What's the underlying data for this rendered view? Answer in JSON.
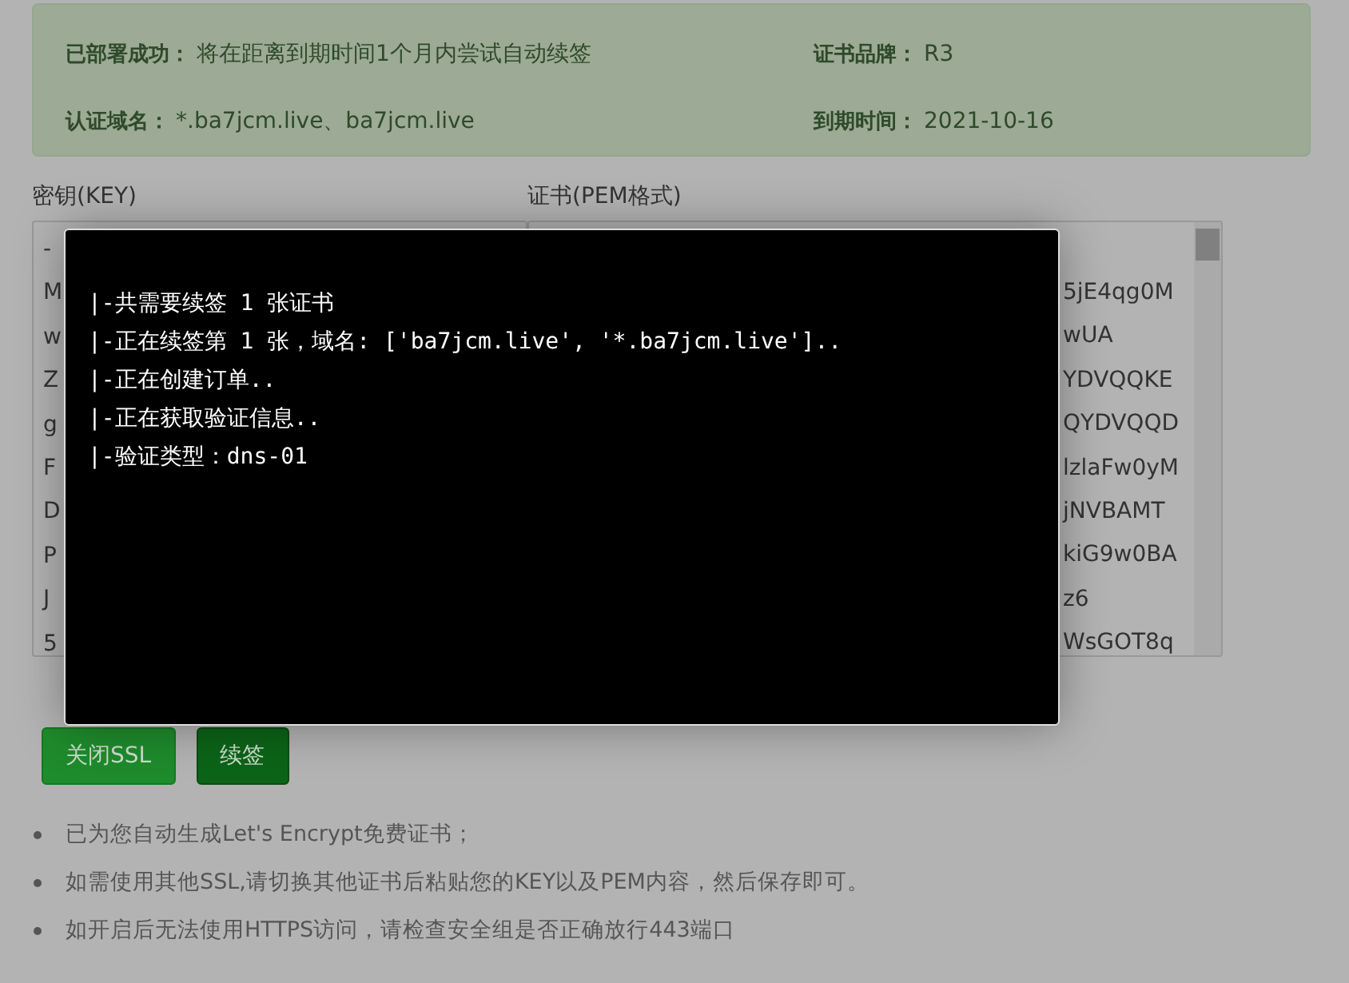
{
  "alert": {
    "items": [
      {
        "label": "已部署成功：",
        "value": "将在距离到期时间1个月内尝试自动续签"
      },
      {
        "label": "证书品牌：",
        "value": "R3"
      },
      {
        "label": "认证域名：",
        "value": "*.ba7jcm.live、ba7jcm.live"
      },
      {
        "label": "到期时间：",
        "value": "2021-10-16"
      }
    ]
  },
  "key": {
    "label": "密钥(KEY)",
    "lines": [
      "-",
      "M",
      "w",
      "Z",
      "g",
      "F",
      "D",
      "P",
      "J",
      "5"
    ]
  },
  "cert": {
    "label": "证书(PEM格式)",
    "lines": [
      "5jE4qg0M",
      "wUA",
      "YDVQQKE",
      "QYDVQQD",
      "lzlaFw0yM",
      "jNVBAMT",
      "kiG9w0BA",
      "z6",
      "WsGOT8q"
    ]
  },
  "buttons": [
    {
      "label": "关闭SSL",
      "kind": "light"
    },
    {
      "label": "续签",
      "kind": "dark"
    }
  ],
  "notes": [
    "已为您自动生成Let's Encrypt免费证书；",
    "如需使用其他SSL,请切换其他证书后粘贴您的KEY以及PEM内容，然后保存即可。",
    "如开启后无法使用HTTPS访问，请检查安全组是否正确放行443端口"
  ],
  "console": {
    "lines": [
      "|-共需要续签 1 张证书",
      "|-正在续签第 1 张，域名: ['ba7jcm.live', '*.ba7jcm.live']..",
      "|-正在创建订单..",
      "|-正在获取验证信息..",
      "|-验证类型：dns-01"
    ]
  }
}
